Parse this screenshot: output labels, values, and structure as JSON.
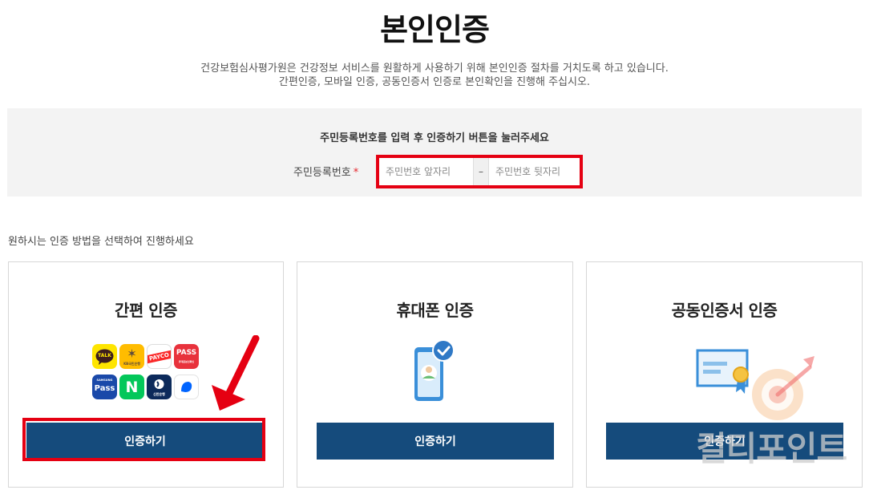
{
  "page": {
    "title": "본인인증",
    "description_line1": "건강보험심사평가원은 건강정보 서비스를 원활하게 사용하기 위해 본인인증 절차를 거치도록 하고 있습니다.",
    "description_line2": "간편인증, 모바일 인증, 공동인증서 인증로 본인확인을 진행해 주십시오."
  },
  "id_form": {
    "instruction": "주민등록번호를 입력 후 인증하기 버튼을 눌러주세요",
    "label": "주민등록번호",
    "required_mark": "*",
    "front_placeholder": "주민번호 앞자리",
    "separator": "–",
    "back_placeholder": "주민번호 뒷자리"
  },
  "methods": {
    "guide": "원하시는 인증 방법을 선택하여 진행하세요",
    "cards": [
      {
        "title": "간편 인증",
        "button": "인증하기"
      },
      {
        "title": "휴대폰 인증",
        "button": "인증하기"
      },
      {
        "title": "공동인증서 인증",
        "button": "인증하기"
      }
    ],
    "simple_auth_apps": {
      "kakao": "TALK",
      "kb": "KB국민은행",
      "payco": "PAYCO",
      "pass_red": "PASS",
      "pass_red_sub": "휴대폰본인확인",
      "samsung_top": "SAMSUNG",
      "samsung": "Pass",
      "naver": "N",
      "shinhan": "신한은행",
      "toss": "toss"
    }
  },
  "watermark": {
    "text": "컬티포인트"
  },
  "colors": {
    "button_bg": "#154b7c",
    "highlight_red": "#e50012",
    "panel_bg": "#f3f3f3",
    "required_red": "#e4242b"
  }
}
